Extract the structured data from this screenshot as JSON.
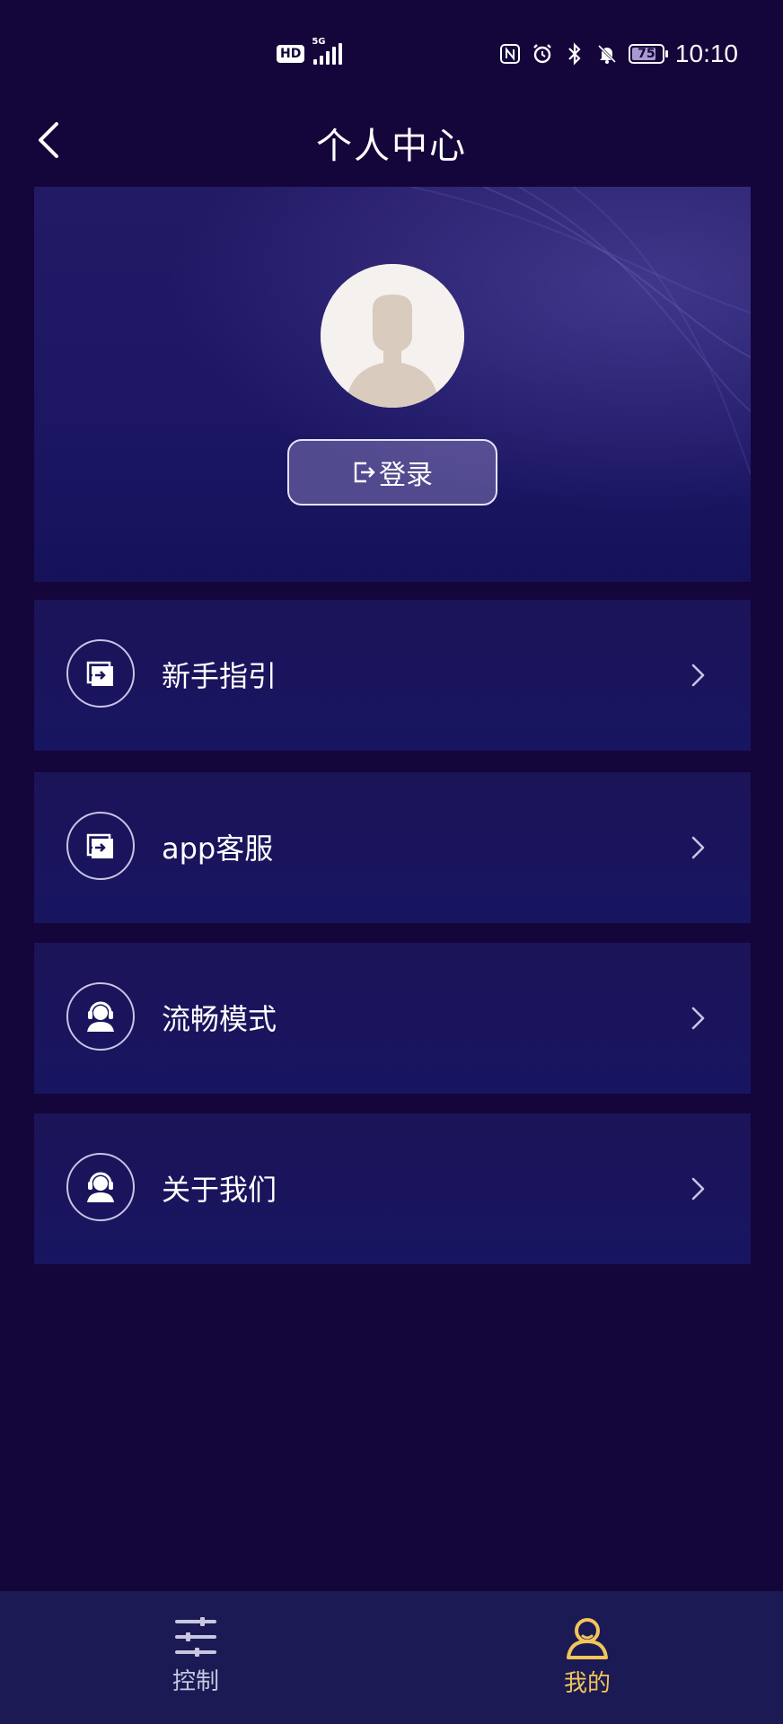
{
  "status_bar": {
    "hd": "HD",
    "network": "5G",
    "battery": "75",
    "time": "10:10"
  },
  "header": {
    "title": "个人中心"
  },
  "profile": {
    "login_label": "登录"
  },
  "menu": [
    {
      "label": "新手指引",
      "icon": "guide-icon"
    },
    {
      "label": "app客服",
      "icon": "guide-icon"
    },
    {
      "label": "流畅模式",
      "icon": "customer-service-icon"
    },
    {
      "label": "关于我们",
      "icon": "customer-service-icon"
    }
  ],
  "tabs": [
    {
      "label": "控制",
      "icon": "sliders-icon",
      "active": false
    },
    {
      "label": "我的",
      "icon": "user-icon",
      "active": true
    }
  ],
  "colors": {
    "background": "#14053a",
    "card": "#1c1458",
    "tab_bar": "#1b1a54",
    "active_tab": "#f1c55a",
    "inactive_tab": "#c9c6e0"
  }
}
